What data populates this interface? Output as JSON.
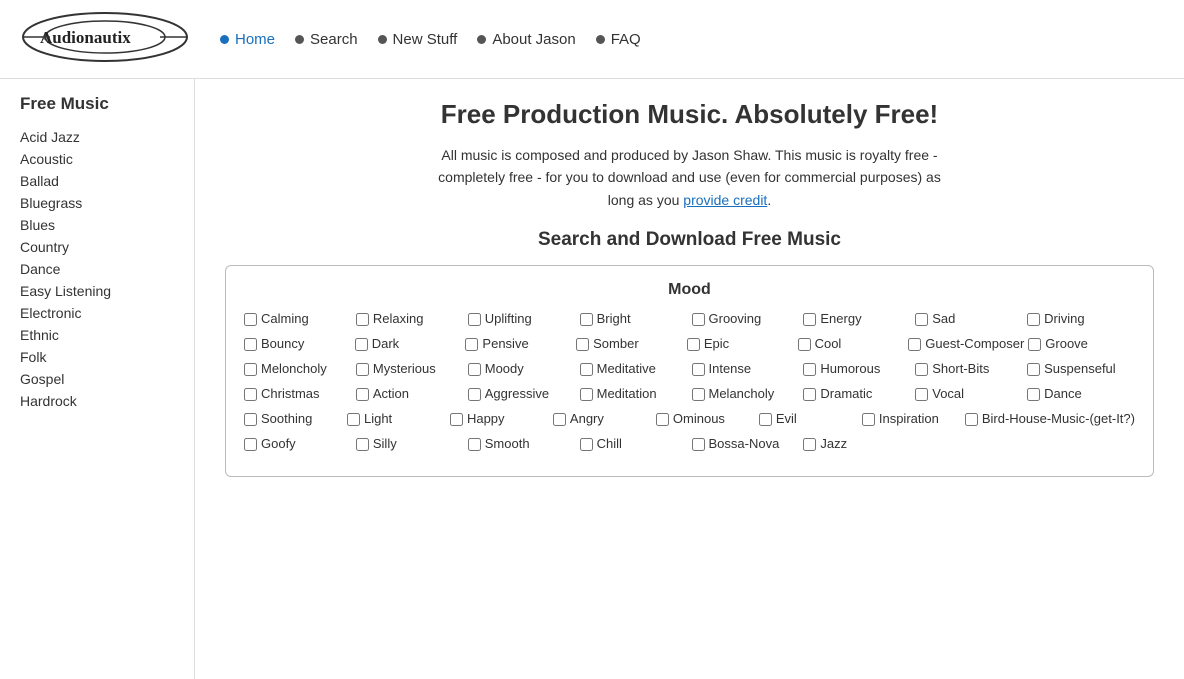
{
  "header": {
    "logo_alt": "Audionautix",
    "nav_items": [
      {
        "label": "Home",
        "active": true
      },
      {
        "label": "Search",
        "active": false
      },
      {
        "label": "New Stuff",
        "active": false
      },
      {
        "label": "About Jason",
        "active": false
      },
      {
        "label": "FAQ",
        "active": false
      }
    ]
  },
  "sidebar": {
    "title": "Free Music",
    "links": [
      "Acid Jazz",
      "Acoustic",
      "Ballad",
      "Bluegrass",
      "Blues",
      "Country",
      "Dance",
      "Easy Listening",
      "Electronic",
      "Ethnic",
      "Folk",
      "Gospel",
      "Hardrock"
    ]
  },
  "main": {
    "title": "Free Production Music. Absolutely Free!",
    "description": "All music is composed and produced by Jason Shaw. This music is royalty free - completely free - for you to download and use (even for commercial purposes) as long as you",
    "link_text": "provide credit",
    "link_suffix": ".",
    "search_title": "Search and Download Free Music",
    "mood_label": "Mood",
    "mood_rows": [
      [
        "Calming",
        "Relaxing",
        "Uplifting",
        "Bright",
        "Grooving",
        "Energy",
        "Sad",
        "Driving"
      ],
      [
        "Bouncy",
        "Dark",
        "Pensive",
        "Somber",
        "Epic",
        "Cool",
        "Guest-Composer",
        "Groove"
      ],
      [
        "Meloncholy",
        "Mysterious",
        "Moody",
        "Meditative",
        "Intense",
        "Humorous",
        "Short-Bits",
        "Suspenseful"
      ],
      [
        "Christmas",
        "Action",
        "Aggressive",
        "Meditation",
        "Melancholy",
        "Dramatic",
        "Vocal",
        "Dance"
      ],
      [
        "Soothing",
        "Light",
        "Happy",
        "Angry",
        "Ominous",
        "Evil",
        "Inspiration",
        "Bird-House-Music-(get-It?)"
      ],
      [
        "Goofy",
        "Silly",
        "Smooth",
        "Chill",
        "Bossa-Nova",
        "Jazz",
        "",
        ""
      ]
    ]
  }
}
